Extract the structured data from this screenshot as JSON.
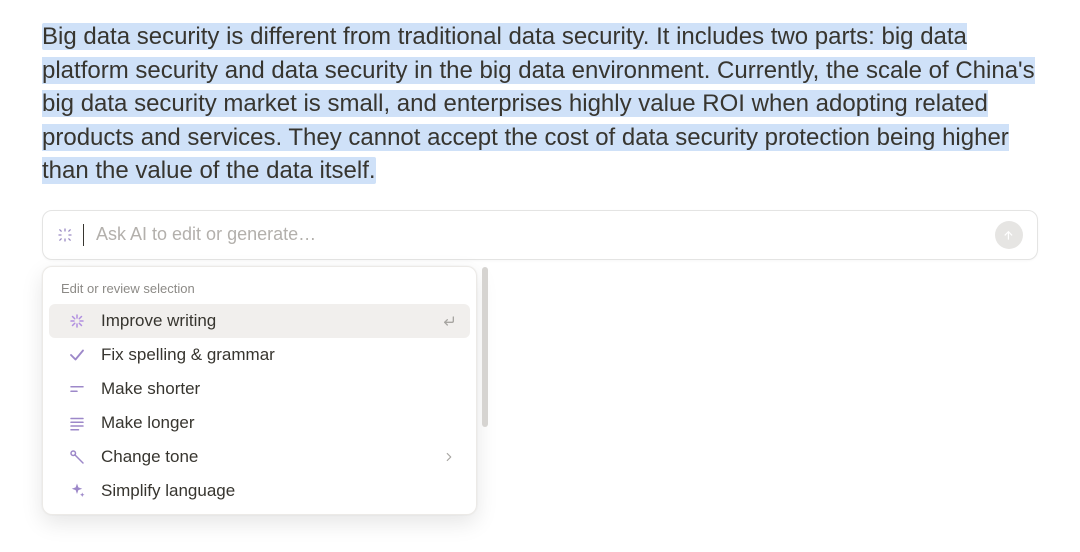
{
  "content": {
    "selected_text": "Big data security is different from traditional data security. It includes two parts: big data platform security and data security in the big data environment. Currently, the scale of China's big data security market is small, and enterprises highly value ROI when adopting related products and services. They cannot accept the cost of data security protection being higher than the value of the data itself."
  },
  "ai_bar": {
    "placeholder": "Ask AI to edit or generate…"
  },
  "dropdown": {
    "section_label": "Edit or review selection",
    "items": [
      {
        "label": "Improve writing",
        "icon": "sparkle-burst-icon",
        "hovered": true,
        "enter": true
      },
      {
        "label": "Fix spelling & grammar",
        "icon": "check-icon"
      },
      {
        "label": "Make shorter",
        "icon": "lines-short-icon"
      },
      {
        "label": "Make longer",
        "icon": "lines-long-icon"
      },
      {
        "label": "Change tone",
        "icon": "mic-pen-icon",
        "submenu": true
      },
      {
        "label": "Simplify language",
        "icon": "sparkle-icon"
      }
    ]
  },
  "colors": {
    "highlight": "#cfe1f8",
    "accent": "#9d88c9"
  }
}
